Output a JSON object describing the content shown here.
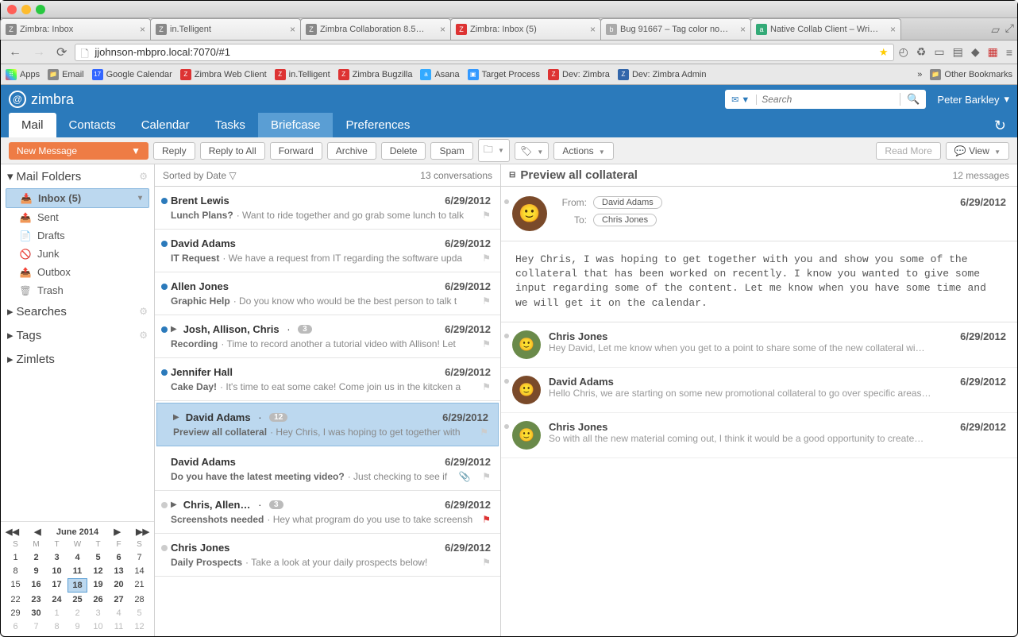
{
  "browser": {
    "tabs": [
      {
        "favicon": "Z",
        "label": "Zimbra: Inbox"
      },
      {
        "favicon": "Z",
        "label": "in.Telligent"
      },
      {
        "favicon": "Z",
        "label": "Zimbra Collaboration 8.5…"
      },
      {
        "favicon": "Z",
        "label": "Zimbra: Inbox (5)"
      },
      {
        "favicon": "b",
        "label": "Bug 91667 – Tag color no…"
      },
      {
        "favicon": "a",
        "label": "Native Collab Client – Wri…"
      }
    ],
    "url": "jjohnson-mbpro.local:7070/#1",
    "bookmarks": {
      "apps": "Apps",
      "items": [
        "Email",
        "Google Calendar",
        "Zimbra Web Client",
        "in.Telligent",
        "Zimbra Bugzilla",
        "Asana",
        "Target Process",
        "Dev: Zimbra",
        "Dev: Zimbra Admin"
      ],
      "other": "Other Bookmarks"
    }
  },
  "header": {
    "logo": "zimbra",
    "search_placeholder": "Search",
    "user": "Peter Barkley"
  },
  "apptabs": [
    "Mail",
    "Contacts",
    "Calendar",
    "Tasks",
    "Briefcase",
    "Preferences"
  ],
  "toolbar": {
    "newmsg": "New Message",
    "reply": "Reply",
    "replyall": "Reply to All",
    "forward": "Forward",
    "archive": "Archive",
    "delete": "Delete",
    "spam": "Spam",
    "actions": "Actions",
    "readmore": "Read More",
    "view": "View"
  },
  "sidebar": {
    "mailfolders": "Mail Folders",
    "folders": [
      {
        "name": "Inbox (5)",
        "selected": true
      },
      {
        "name": "Sent"
      },
      {
        "name": "Drafts"
      },
      {
        "name": "Junk"
      },
      {
        "name": "Outbox"
      },
      {
        "name": "Trash"
      }
    ],
    "searches": "Searches",
    "tags": "Tags",
    "zimlets": "Zimlets",
    "calendar": {
      "title": "June 2014",
      "dow": [
        "S",
        "M",
        "T",
        "W",
        "T",
        "F",
        "S"
      ],
      "weeks": [
        [
          {
            "d": "1"
          },
          {
            "d": "2",
            "b": 1
          },
          {
            "d": "3",
            "b": 1
          },
          {
            "d": "4",
            "b": 1
          },
          {
            "d": "5",
            "b": 1
          },
          {
            "d": "6",
            "b": 1
          },
          {
            "d": "7"
          }
        ],
        [
          {
            "d": "8"
          },
          {
            "d": "9",
            "b": 1
          },
          {
            "d": "10",
            "b": 1
          },
          {
            "d": "11",
            "b": 1
          },
          {
            "d": "12",
            "b": 1
          },
          {
            "d": "13",
            "b": 1
          },
          {
            "d": "14"
          }
        ],
        [
          {
            "d": "15"
          },
          {
            "d": "16",
            "b": 1
          },
          {
            "d": "17",
            "b": 1
          },
          {
            "d": "18",
            "today": 1
          },
          {
            "d": "19",
            "b": 1
          },
          {
            "d": "20",
            "b": 1
          },
          {
            "d": "21"
          }
        ],
        [
          {
            "d": "22"
          },
          {
            "d": "23",
            "b": 1
          },
          {
            "d": "24",
            "b": 1
          },
          {
            "d": "25",
            "b": 1
          },
          {
            "d": "26",
            "b": 1
          },
          {
            "d": "27",
            "b": 1
          },
          {
            "d": "28"
          }
        ],
        [
          {
            "d": "29"
          },
          {
            "d": "30",
            "b": 1
          },
          {
            "d": "1",
            "o": 1
          },
          {
            "d": "2",
            "o": 1
          },
          {
            "d": "3",
            "o": 1
          },
          {
            "d": "4",
            "o": 1
          },
          {
            "d": "5",
            "o": 1
          }
        ],
        [
          {
            "d": "6",
            "o": 1
          },
          {
            "d": "7",
            "o": 1
          },
          {
            "d": "8",
            "o": 1
          },
          {
            "d": "9",
            "o": 1
          },
          {
            "d": "10",
            "o": 1
          },
          {
            "d": "11",
            "o": 1
          },
          {
            "d": "12",
            "o": 1
          }
        ]
      ]
    }
  },
  "list": {
    "sort": "Sorted by Date",
    "count": "13 conversations",
    "items": [
      {
        "unread": true,
        "sender": "Brent Lewis",
        "date": "6/29/2012",
        "subject": "Lunch Plans?",
        "snippet": "Want to ride together and go grab some lunch to talk"
      },
      {
        "unread": true,
        "sender": "David Adams",
        "date": "6/29/2012",
        "subject": "IT Request",
        "snippet": "We have a request from IT regarding the software upda"
      },
      {
        "unread": true,
        "sender": "Allen Jones",
        "date": "6/29/2012",
        "subject": "Graphic Help",
        "snippet": "Do you know who would be the best person to talk t"
      },
      {
        "unread": true,
        "exp": true,
        "sender": "Josh, Allison, Chris",
        "count": "3",
        "date": "6/29/2012",
        "subject": "Recording",
        "snippet": "Time to record another a tutorial video with Allison! Let"
      },
      {
        "unread": true,
        "sender": "Jennifer Hall",
        "date": "6/29/2012",
        "subject": "Cake Day!",
        "snippet": "It's time to eat some cake! Come join us in the kitcken a"
      },
      {
        "selected": true,
        "exp": true,
        "sender": "David Adams",
        "count": "12",
        "date": "6/29/2012",
        "subject": "Preview all collateral",
        "snippet": "Hey Chris, I was hoping to get together with"
      },
      {
        "sender": "David Adams",
        "date": "6/29/2012",
        "subject": "Do you have the latest meeting video?",
        "snippet": "Just checking to see if",
        "clip": true
      },
      {
        "gray": true,
        "exp": true,
        "sender": "Chris, Allen…",
        "count": "3",
        "date": "6/29/2012",
        "subject": "Screenshots needed",
        "snippet": "Hey what program do you use to take screensh",
        "flag": "red"
      },
      {
        "gray": true,
        "sender": "Chris Jones",
        "date": "6/29/2012",
        "subject": "Daily Prospects",
        "snippet": "Take a look at your daily prospects below!"
      }
    ]
  },
  "preview": {
    "title": "Preview all collateral",
    "count": "12 messages",
    "from_label": "From:",
    "to_label": "To:",
    "from": "David Adams",
    "to": "Chris Jones",
    "date": "6/29/2012",
    "body": "Hey Chris, I was hoping to get together with you and show you some of the collateral that has been worked on recently. I know you wanted to give some input regarding some of the content. Let me know when you have some time and we will get it on the calendar.",
    "thread": [
      {
        "name": "Chris Jones",
        "date": "6/29/2012",
        "snippet": "Hey David, Let me know when you get to a point to share some of the new collateral wi…",
        "avclr": "#6a8a4a"
      },
      {
        "name": "David Adams",
        "date": "6/29/2012",
        "snippet": "Hello Chris, we are starting on some new promotional collateral to go over specific areas…",
        "avclr": "#7a4a2a"
      },
      {
        "name": "Chris Jones",
        "date": "6/29/2012",
        "snippet": "So with all the new material coming out, I think it would be a good opportunity to create…",
        "avclr": "#6a8a4a"
      }
    ]
  }
}
